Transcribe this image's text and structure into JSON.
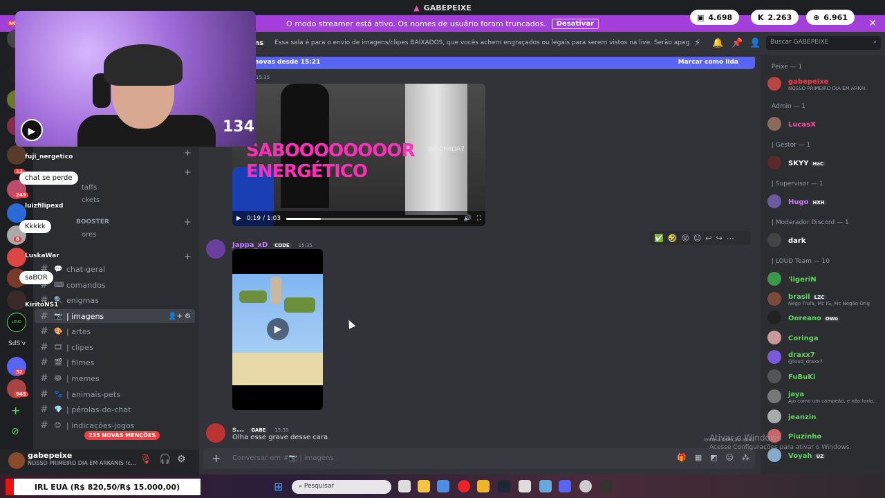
{
  "window": {
    "title": "GABEPEIXE"
  },
  "streamer_banner": {
    "text": "O modo streamer está ativo. Os nomes de usuário foram truncados.",
    "button": "Desativar"
  },
  "stats": [
    {
      "icon": "twitch-icon",
      "value": "4.698"
    },
    {
      "icon": "kick-icon",
      "value": "2.263"
    },
    {
      "icon": "viewers-icon",
      "value": "6.961"
    }
  ],
  "channel_header": {
    "name": "ns",
    "topic": "Essa sala é para o envio de imagens/clipes BAIXADOS, que vocês achem engraçados ou legais para serem vistos na live. Serão apagados prints de o...",
    "search_placeholder": "Buscar GABEPEIXE"
  },
  "new_messages_bar": {
    "left": "novas desde 15:21",
    "right": "Marcar como lida"
  },
  "sidebar": {
    "channels": [
      {
        "emoji": "💬",
        "label": "chat-geral"
      },
      {
        "emoji": "⌨",
        "label": "comandos"
      },
      {
        "emoji": "🔍",
        "label": "enigmas"
      },
      {
        "emoji": "📷",
        "label": "| imagens",
        "active": true
      },
      {
        "emoji": "🎨",
        "label": "| artes"
      },
      {
        "emoji": "🎞",
        "label": "| clipes"
      },
      {
        "emoji": "🎬",
        "label": "| filmes"
      },
      {
        "emoji": "😂",
        "label": "| memes"
      },
      {
        "emoji": "🐾",
        "label": "| animais-pets"
      },
      {
        "emoji": "💎",
        "label": "| pérolas-do-chat"
      },
      {
        "emoji": "😊",
        "label": "| indicações-jogos"
      }
    ],
    "partial": {
      "staffs": "taffs",
      "tickets": "ckets",
      "booster": "BOOSTER",
      "cores": "ores"
    },
    "mentions_badge": "235 NOVAS MENÇÕES"
  },
  "rail_badges": [
    "NO",
    "12",
    "245",
    "8",
    "32",
    "945"
  ],
  "rail_labels": {
    "loud": "LOUD",
    "sds": "SdS'v"
  },
  "user_panel": {
    "name": "gabepeixe",
    "status": "NOSSO PRIMEIRO DIA EM ARKANIS !c..."
  },
  "messages": {
    "video1": {
      "time": "15:35",
      "caption": "SABOOOOOOOOR ENERGÉTICO",
      "handle": "@MCHKOA7",
      "timestamp": "0:19 / 1:03",
      "progress": 0.2
    },
    "msg2": {
      "author": "Jappa_xD",
      "tag": "CODE",
      "time": "15:35"
    },
    "msg3": {
      "author": "s...",
      "tag": "GABE",
      "time": "15:35",
      "reply_text": "Olha esse grave desse cara",
      "note": "Imhe a seleção atual"
    }
  },
  "composer": {
    "placeholder": "Conversar em #📷 | imagens"
  },
  "members": {
    "groups": [
      {
        "role": "Peixe — 1",
        "members": [
          {
            "name": "gabepeixe",
            "color": "#f23f42",
            "sub": "NOSSO PRIMEIRO DIA EM ARKAI"
          }
        ]
      },
      {
        "role": "Admin — 1",
        "members": [
          {
            "name": "LucasX",
            "color": "#e75aa8",
            "sub": ""
          }
        ]
      },
      {
        "role": "| Gestor — 1",
        "members": [
          {
            "name": "SKYY",
            "color": "#ffffff",
            "sub": "",
            "tag": "HaC"
          }
        ]
      },
      {
        "role": "| Supervisor — 1",
        "members": [
          {
            "name": "Hugo",
            "color": "#c77dff",
            "sub": "",
            "tag": "HXH"
          }
        ]
      },
      {
        "role": "| Moderador Discord — 1",
        "members": [
          {
            "name": "dark",
            "color": "#ffffff",
            "sub": ""
          }
        ]
      },
      {
        "role": "| LOUD Team — 10",
        "members": [
          {
            "name": "'ligeriN",
            "color": "#5dd65d",
            "sub": ""
          },
          {
            "name": "brasil",
            "color": "#5dd65d",
            "sub": "Nego Trufa, Mc IG, Mc Negão Orig",
            "tag": "LZC"
          },
          {
            "name": "Ooreano",
            "color": "#5dd65d",
            "sub": "",
            "tag": "OWo"
          },
          {
            "name": "Coringa",
            "color": "#5dd65d",
            "sub": ""
          },
          {
            "name": "draxx7",
            "color": "#5dd65d",
            "sub": "@loud_draxx7"
          },
          {
            "name": "FuBuKi",
            "color": "#5dd65d",
            "sub": ""
          },
          {
            "name": "jaya",
            "color": "#5dd65d",
            "sub": "Ajo como um campeão, e não faria..."
          },
          {
            "name": "jeanzin",
            "color": "#5dd65d",
            "sub": ""
          },
          {
            "name": "Piuzinho",
            "color": "#5dd65d",
            "sub": ""
          },
          {
            "name": "Voyah",
            "color": "#5dd65d",
            "sub": "",
            "tag": "UZ"
          }
        ]
      }
    ]
  },
  "webcam": {
    "viewer_count": "134"
  },
  "chat_overlay": [
    {
      "name": "fuji_nergetico",
      "text": "chat se perde"
    },
    {
      "name": "luizfilipexd",
      "text": "Kkkkk"
    },
    {
      "name": "LuskaWar",
      "text": "saBOR"
    },
    {
      "name": "KiritoNS1",
      "text": ""
    }
  ],
  "taskbar": {
    "market": "IRL EUA (R$ 820,50/R$ 15.000,00)",
    "search": "Pesquisar"
  },
  "watermark": {
    "line1": "Ativar o Windows",
    "line2": "Acesse Configurações para ativar o Windows."
  }
}
